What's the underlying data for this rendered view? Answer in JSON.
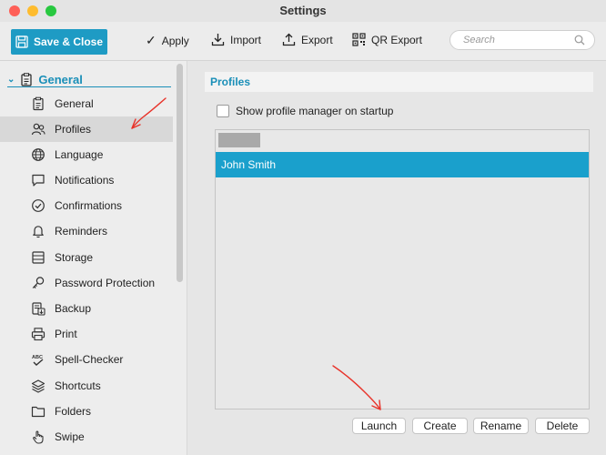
{
  "window": {
    "title": "Settings",
    "traffic_light_colors": {
      "close": "#fe5f57",
      "minimize": "#febc2e",
      "maximize": "#28c840"
    }
  },
  "toolbar": {
    "save_close_label": "Save & Close",
    "apply_label": "Apply",
    "import_label": "Import",
    "export_label": "Export",
    "qr_export_label": "QR Export",
    "search_placeholder": "Search"
  },
  "sidebar": {
    "group_label": "General",
    "items": [
      {
        "label": "General",
        "icon": "clipboard-icon"
      },
      {
        "label": "Profiles",
        "icon": "users-icon",
        "selected": true
      },
      {
        "label": "Language",
        "icon": "globe-icon"
      },
      {
        "label": "Notifications",
        "icon": "speech-bubble-icon"
      },
      {
        "label": "Confirmations",
        "icon": "check-circle-icon"
      },
      {
        "label": "Reminders",
        "icon": "bell-icon"
      },
      {
        "label": "Storage",
        "icon": "database-icon"
      },
      {
        "label": "Password Protection",
        "icon": "key-icon"
      },
      {
        "label": "Backup",
        "icon": "backup-icon"
      },
      {
        "label": "Print",
        "icon": "printer-icon"
      },
      {
        "label": "Spell-Checker",
        "icon": "spell-check-icon"
      },
      {
        "label": "Shortcuts",
        "icon": "layers-icon"
      },
      {
        "label": "Folders",
        "icon": "folder-icon"
      },
      {
        "label": "Swipe",
        "icon": "hand-icon"
      }
    ]
  },
  "main": {
    "section_title": "Profiles",
    "show_manager_label": "Show profile manager on startup",
    "show_manager_checked": false,
    "profiles": [
      "John Smith"
    ],
    "selected_profile_index": 0,
    "buttons": {
      "launch": "Launch",
      "create": "Create",
      "rename": "Rename",
      "delete": "Delete"
    }
  },
  "colors": {
    "accent": "#1a8fb8",
    "selection": "#1aa0cc",
    "annotation": "#e8332a"
  }
}
